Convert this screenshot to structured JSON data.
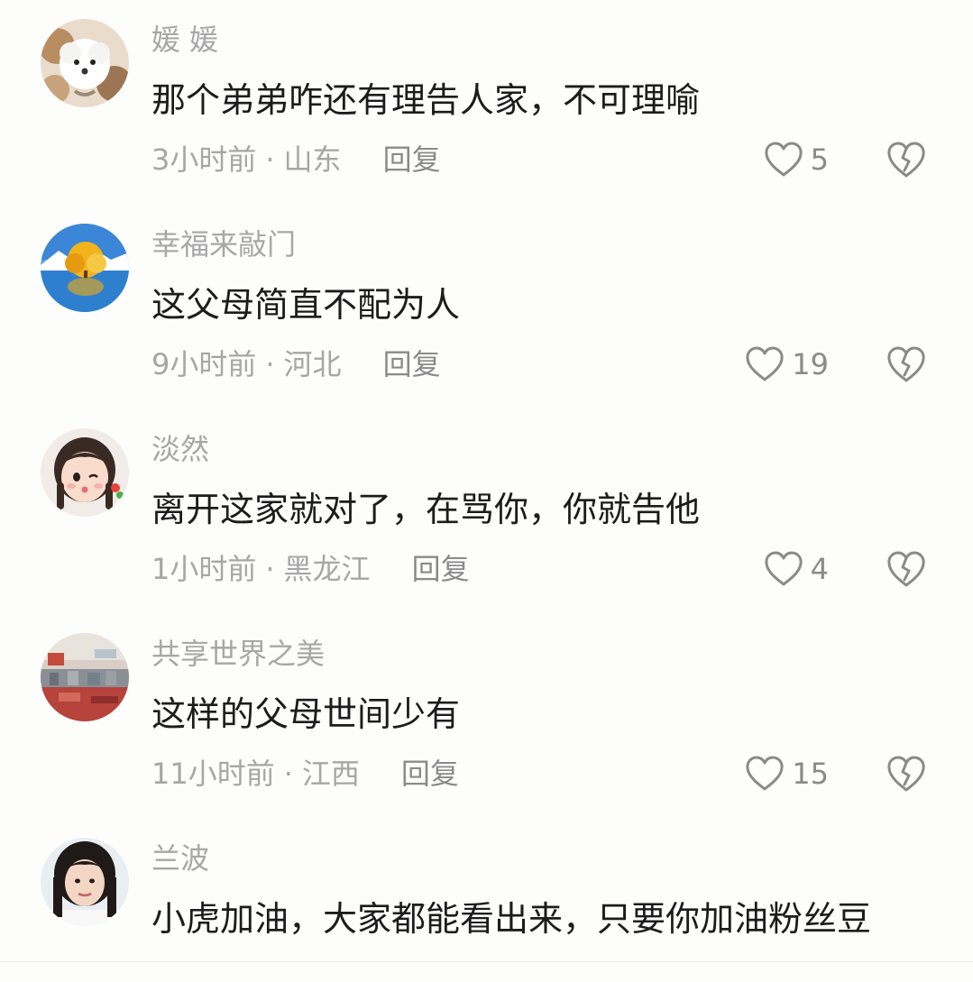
{
  "comments": [
    {
      "username": "媛 媛",
      "text": "那个弟弟咋还有理告人家，不可理喻",
      "time": "3小时前",
      "sep": "·",
      "location": "山东",
      "reply_label": "回复",
      "likes": "5"
    },
    {
      "username": "幸福来敲门",
      "text": "这父母简直不配为人",
      "time": "9小时前",
      "sep": "·",
      "location": "河北",
      "reply_label": "回复",
      "likes": "19"
    },
    {
      "username": "淡然",
      "text": "离开这家就对了，在骂你，你就告他",
      "time": "1小时前",
      "sep": "·",
      "location": "黑龙江",
      "reply_label": "回复",
      "likes": "4"
    },
    {
      "username": "共享世界之美",
      "text": "这样的父母世间少有",
      "time": "11小时前",
      "sep": "·",
      "location": "江西",
      "reply_label": "回复",
      "likes": "15"
    },
    {
      "username": "兰波",
      "text": "小虎加油，大家都能看出来，只要你加油粉丝豆"
    }
  ],
  "colors": {
    "background": "#fdfdfc",
    "username": "#a7a7a7",
    "text": "#1c1c1c",
    "meta": "#a6a6a6",
    "icon": "#8a8a8a"
  },
  "icons": {
    "like": "heart-outline-icon",
    "dislike": "broken-heart-icon"
  }
}
